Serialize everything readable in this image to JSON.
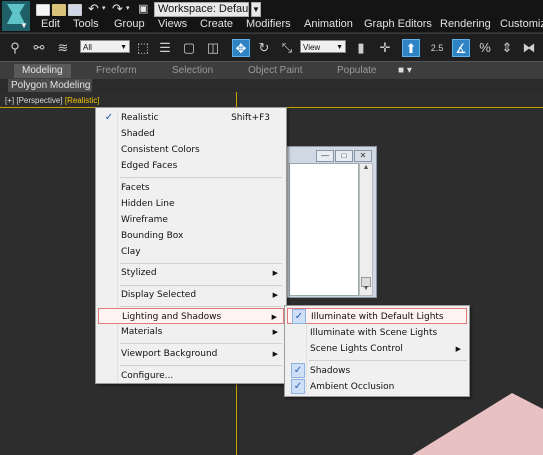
{
  "window": {
    "workspace_label": "Workspace: Default",
    "workspace_arrow": "▼",
    "logo_dropdown": "▼"
  },
  "menubar": [
    "Edit",
    "Tools",
    "Group",
    "Views",
    "Create",
    "Modifiers",
    "Animation",
    "Graph Editors",
    "Rendering",
    "Customize"
  ],
  "toolbar": {
    "selection_filter": "All",
    "reference_coord": "View",
    "icons": [
      "select-link-icon",
      "unlink-icon",
      "bind-space-warp-icon",
      "select-object-icon",
      "select-by-name-icon",
      "rectangular-region-icon",
      "window-crossing-icon",
      "select-move-icon",
      "select-rotate-icon",
      "select-scale-icon",
      "mirror-icon",
      "use-pivot-icon",
      "select-manipulate-icon",
      "snaps-toggle-icon",
      "angle-snap-icon",
      "percent-snap-icon",
      "spinner-snap-icon"
    ],
    "snap_labels": {
      "two_five": "2.5",
      "percent": "%"
    }
  },
  "ribbon": {
    "tabs": [
      "Modeling",
      "Freeform",
      "Selection",
      "Object Paint",
      "Populate"
    ],
    "active_tab": "Modeling",
    "panel_label": "Polygon Modeling"
  },
  "viewport": {
    "label_plus": "[+]",
    "label_view": "[Perspective]",
    "label_shading": "[Realistic]"
  },
  "dialog": {
    "minimize": "—",
    "maximize": "□",
    "close": "✕",
    "scroll_up": "▲",
    "scroll_down": "▼"
  },
  "context_menu": {
    "items": [
      {
        "label": "Realistic",
        "shortcut": "Shift+F3",
        "checked": true
      },
      {
        "label": "Shaded"
      },
      {
        "label": "Consistent Colors"
      },
      {
        "label": "Edged Faces"
      },
      {
        "label": "Facets"
      },
      {
        "label": "Hidden Line"
      },
      {
        "label": "Wireframe"
      },
      {
        "label": "Bounding Box"
      },
      {
        "label": "Clay"
      },
      {
        "label": "Stylized",
        "submenu": true
      },
      {
        "label": "Display Selected",
        "submenu": true
      },
      {
        "label": "Lighting and Shadows",
        "submenu": true,
        "highlighted": true
      },
      {
        "label": "Materials",
        "submenu": true
      },
      {
        "label": "Viewport Background",
        "submenu": true
      },
      {
        "label": "Configure..."
      }
    ],
    "check_glyph": "✓",
    "submenu_glyph": "▶"
  },
  "lighting_submenu": {
    "items": [
      {
        "label": "Illuminate with Default Lights",
        "checked": true,
        "highlighted": true
      },
      {
        "label": "Illuminate with Scene Lights"
      },
      {
        "label": "Scene Lights Control",
        "submenu": true
      },
      {
        "label": "Shadows",
        "checked": true
      },
      {
        "label": "Ambient Occlusion",
        "checked": true
      }
    ]
  },
  "colors": {
    "viewport_border": "#c9a100",
    "highlight_border": "#e07b7b",
    "accent_blue": "#2e83c5",
    "pink_object": "#e8c2c2"
  }
}
